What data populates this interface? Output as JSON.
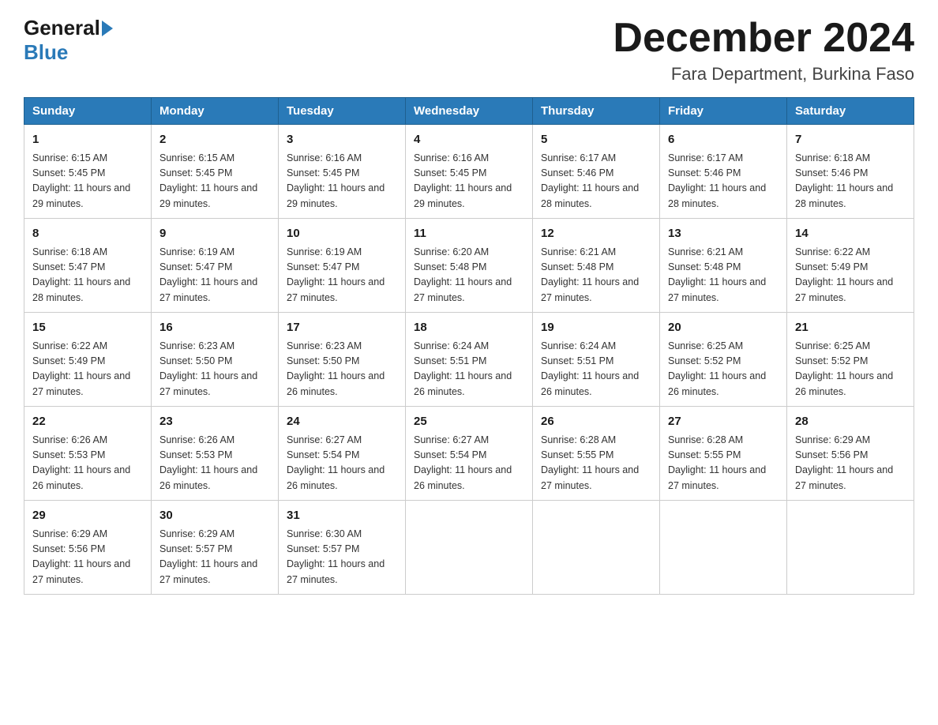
{
  "logo": {
    "general": "General",
    "blue": "Blue"
  },
  "title": {
    "month_year": "December 2024",
    "location": "Fara Department, Burkina Faso"
  },
  "headers": [
    "Sunday",
    "Monday",
    "Tuesday",
    "Wednesday",
    "Thursday",
    "Friday",
    "Saturday"
  ],
  "weeks": [
    [
      {
        "day": "1",
        "sunrise": "6:15 AM",
        "sunset": "5:45 PM",
        "daylight": "11 hours and 29 minutes."
      },
      {
        "day": "2",
        "sunrise": "6:15 AM",
        "sunset": "5:45 PM",
        "daylight": "11 hours and 29 minutes."
      },
      {
        "day": "3",
        "sunrise": "6:16 AM",
        "sunset": "5:45 PM",
        "daylight": "11 hours and 29 minutes."
      },
      {
        "day": "4",
        "sunrise": "6:16 AM",
        "sunset": "5:45 PM",
        "daylight": "11 hours and 29 minutes."
      },
      {
        "day": "5",
        "sunrise": "6:17 AM",
        "sunset": "5:46 PM",
        "daylight": "11 hours and 28 minutes."
      },
      {
        "day": "6",
        "sunrise": "6:17 AM",
        "sunset": "5:46 PM",
        "daylight": "11 hours and 28 minutes."
      },
      {
        "day": "7",
        "sunrise": "6:18 AM",
        "sunset": "5:46 PM",
        "daylight": "11 hours and 28 minutes."
      }
    ],
    [
      {
        "day": "8",
        "sunrise": "6:18 AM",
        "sunset": "5:47 PM",
        "daylight": "11 hours and 28 minutes."
      },
      {
        "day": "9",
        "sunrise": "6:19 AM",
        "sunset": "5:47 PM",
        "daylight": "11 hours and 27 minutes."
      },
      {
        "day": "10",
        "sunrise": "6:19 AM",
        "sunset": "5:47 PM",
        "daylight": "11 hours and 27 minutes."
      },
      {
        "day": "11",
        "sunrise": "6:20 AM",
        "sunset": "5:48 PM",
        "daylight": "11 hours and 27 minutes."
      },
      {
        "day": "12",
        "sunrise": "6:21 AM",
        "sunset": "5:48 PM",
        "daylight": "11 hours and 27 minutes."
      },
      {
        "day": "13",
        "sunrise": "6:21 AM",
        "sunset": "5:48 PM",
        "daylight": "11 hours and 27 minutes."
      },
      {
        "day": "14",
        "sunrise": "6:22 AM",
        "sunset": "5:49 PM",
        "daylight": "11 hours and 27 minutes."
      }
    ],
    [
      {
        "day": "15",
        "sunrise": "6:22 AM",
        "sunset": "5:49 PM",
        "daylight": "11 hours and 27 minutes."
      },
      {
        "day": "16",
        "sunrise": "6:23 AM",
        "sunset": "5:50 PM",
        "daylight": "11 hours and 27 minutes."
      },
      {
        "day": "17",
        "sunrise": "6:23 AM",
        "sunset": "5:50 PM",
        "daylight": "11 hours and 26 minutes."
      },
      {
        "day": "18",
        "sunrise": "6:24 AM",
        "sunset": "5:51 PM",
        "daylight": "11 hours and 26 minutes."
      },
      {
        "day": "19",
        "sunrise": "6:24 AM",
        "sunset": "5:51 PM",
        "daylight": "11 hours and 26 minutes."
      },
      {
        "day": "20",
        "sunrise": "6:25 AM",
        "sunset": "5:52 PM",
        "daylight": "11 hours and 26 minutes."
      },
      {
        "day": "21",
        "sunrise": "6:25 AM",
        "sunset": "5:52 PM",
        "daylight": "11 hours and 26 minutes."
      }
    ],
    [
      {
        "day": "22",
        "sunrise": "6:26 AM",
        "sunset": "5:53 PM",
        "daylight": "11 hours and 26 minutes."
      },
      {
        "day": "23",
        "sunrise": "6:26 AM",
        "sunset": "5:53 PM",
        "daylight": "11 hours and 26 minutes."
      },
      {
        "day": "24",
        "sunrise": "6:27 AM",
        "sunset": "5:54 PM",
        "daylight": "11 hours and 26 minutes."
      },
      {
        "day": "25",
        "sunrise": "6:27 AM",
        "sunset": "5:54 PM",
        "daylight": "11 hours and 26 minutes."
      },
      {
        "day": "26",
        "sunrise": "6:28 AM",
        "sunset": "5:55 PM",
        "daylight": "11 hours and 27 minutes."
      },
      {
        "day": "27",
        "sunrise": "6:28 AM",
        "sunset": "5:55 PM",
        "daylight": "11 hours and 27 minutes."
      },
      {
        "day": "28",
        "sunrise": "6:29 AM",
        "sunset": "5:56 PM",
        "daylight": "11 hours and 27 minutes."
      }
    ],
    [
      {
        "day": "29",
        "sunrise": "6:29 AM",
        "sunset": "5:56 PM",
        "daylight": "11 hours and 27 minutes."
      },
      {
        "day": "30",
        "sunrise": "6:29 AM",
        "sunset": "5:57 PM",
        "daylight": "11 hours and 27 minutes."
      },
      {
        "day": "31",
        "sunrise": "6:30 AM",
        "sunset": "5:57 PM",
        "daylight": "11 hours and 27 minutes."
      },
      null,
      null,
      null,
      null
    ]
  ],
  "labels": {
    "sunrise": "Sunrise: ",
    "sunset": "Sunset: ",
    "daylight": "Daylight: "
  }
}
